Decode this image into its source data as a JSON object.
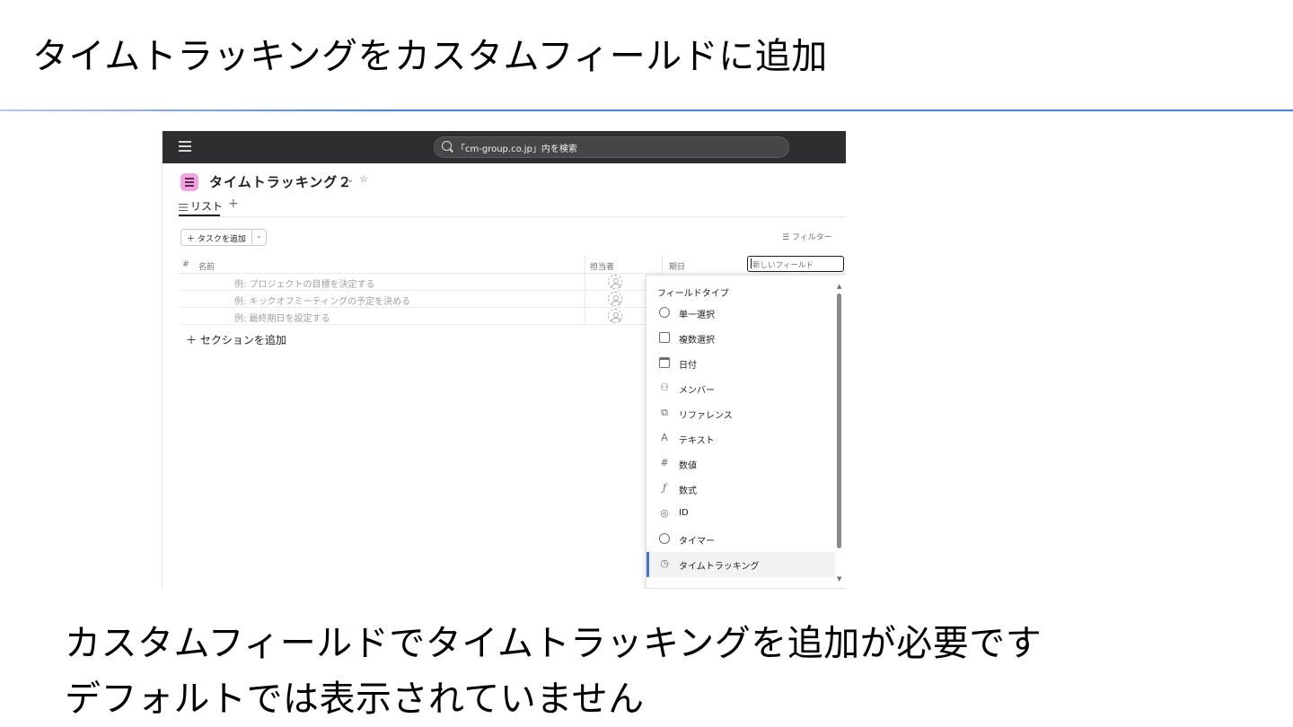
{
  "slide": {
    "title": "タイムトラッキングをカスタムフィールドに追加",
    "caption_line1": "カスタムフィールドでタイムトラッキングを追加が必要です",
    "caption_line2": "デフォルトでは表示されていません"
  },
  "app": {
    "search_text": "「cm-group.co.jp」内を検索",
    "project_title": "タイムトラッキング２",
    "tabs": [
      {
        "label": "リスト"
      }
    ],
    "add_task_label": "＋ タスクを追加",
    "filter_label": "フィルター",
    "columns": {
      "number": "#",
      "name": "名前",
      "assignee": "担当者",
      "due_date": "期日"
    },
    "new_field_placeholder": "新しいフィールド",
    "rows": [
      {
        "name": "例: プロジェクトの目標を決定する"
      },
      {
        "name": "例: キックオフミーティングの予定を決める"
      },
      {
        "name": "例: 最終期日を設定する"
      }
    ],
    "add_section_label": "＋ セクションを追加",
    "dropdown": {
      "header": "フィールドタイプ",
      "items": [
        {
          "label": "単一選択",
          "icon": "circle-check-icon"
        },
        {
          "label": "複数選択",
          "icon": "box-check-icon"
        },
        {
          "label": "日付",
          "icon": "calendar-icon"
        },
        {
          "label": "メンバー",
          "icon": "person-icon"
        },
        {
          "label": "リファレンス",
          "icon": "reference-icon"
        },
        {
          "label": "テキスト",
          "icon": "text-icon"
        },
        {
          "label": "数値",
          "icon": "hash-icon"
        },
        {
          "label": "数式",
          "icon": "formula-icon"
        },
        {
          "label": "ID",
          "icon": "fingerprint-icon"
        },
        {
          "label": "タイマー",
          "icon": "clock-icon"
        },
        {
          "label": "タイムトラッキング",
          "icon": "stopwatch-icon",
          "selected": true
        }
      ]
    }
  },
  "colors": {
    "topbar": "#2e2e30",
    "project_icon": "#f1a3de",
    "accent": "#4573d2",
    "rule": "#4d7fd6"
  }
}
